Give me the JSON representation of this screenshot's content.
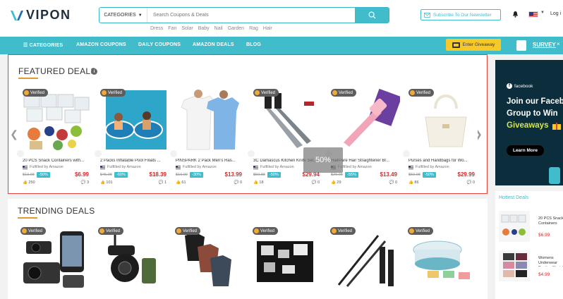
{
  "brand": {
    "name": "VIPON"
  },
  "search": {
    "category_label": "CATEGORIES",
    "placeholder": "Search Coupons & Deals"
  },
  "search_tags": [
    "Dress",
    "Fan",
    "Solar",
    "Baby",
    "Nail",
    "Garden",
    "Rag",
    "Hair"
  ],
  "header": {
    "newsletter_label": "Subscribe To Our Newsletter",
    "login_label": "Log i"
  },
  "nav": {
    "items": [
      "☰ CATEGORIES",
      "AMAZON COUPONS",
      "DAILY COUPONS",
      "AMAZON DEALS",
      "BLOG"
    ],
    "giveaway_label": "Enter Giveaway",
    "survey_label": "SURVEY",
    "survey_close": "×"
  },
  "featured": {
    "title": "FEATURED DEALS",
    "overlay_text": "50%",
    "cards": [
      {
        "badge": "Verified",
        "title": "20 PCS Snack Containers with...",
        "fulfilled": "Fulfilled by Amazon",
        "old_price": "$13.98",
        "discount": "-50%",
        "price": "$6.99",
        "likes": "250",
        "comments": "3"
      },
      {
        "badge": "Verified",
        "title": "2 Packs Inflatable Pool Floats ...",
        "fulfilled": "Fulfilled by Amazon",
        "old_price": "$45.98",
        "discount": "-60%",
        "price": "$18.39",
        "likes": "101",
        "comments": "1"
      },
      {
        "badge": "",
        "title": "PINSPARK 2 Pack Men's Ras...",
        "fulfilled": "Fulfilled by Amazon",
        "old_price": "$19.99",
        "discount": "-30%",
        "price": "$13.99",
        "likes": "61",
        "comments": "0"
      },
      {
        "badge": "Verified",
        "title": "3C Damascus Kitchen Knife Set...",
        "fulfilled": "Fulfilled by Amazon",
        "old_price": "$59.88",
        "discount": "-50%",
        "price": "$29.94",
        "likes": "18",
        "comments": "0"
      },
      {
        "badge": "Verified",
        "title": "HairPare Hair Straightener Br...",
        "fulfilled": "Fulfilled by Amazon",
        "old_price": "$29.98",
        "discount": "-55%",
        "price": "$13.49",
        "likes": "29",
        "comments": "0"
      },
      {
        "badge": "Verified",
        "title": "Purses and Handbags for Wo...",
        "fulfilled": "Fulfilled by Amazon",
        "old_price": "$59.98",
        "discount": "-50%",
        "price": "$29.99",
        "likes": "86",
        "comments": "0"
      }
    ]
  },
  "trending": {
    "title": "TRENDING DEALS",
    "cards": [
      {
        "badge": "Verified"
      },
      {
        "badge": "Verified"
      },
      {
        "badge": "Verified"
      },
      {
        "badge": "Verified"
      },
      {
        "badge": "Verified"
      },
      {
        "badge": "Verified"
      }
    ]
  },
  "facebook_promo": {
    "tag": "facebook",
    "line1": "Join our Faceb",
    "line2": "Group to Win",
    "line3": "Giveaways",
    "button": "Learn More"
  },
  "hottest": {
    "title": "Hottest Deals",
    "items": [
      {
        "name": "20 PCS Snack Containers",
        "price": "$6.99"
      },
      {
        "name": "Womens Underwear Panties Stretch",
        "price": "$4.99"
      }
    ]
  },
  "colors": {
    "teal": "#41bcca",
    "red": "#d92b2b",
    "accent_border": "#e3423a",
    "gold": "#f7c928"
  }
}
